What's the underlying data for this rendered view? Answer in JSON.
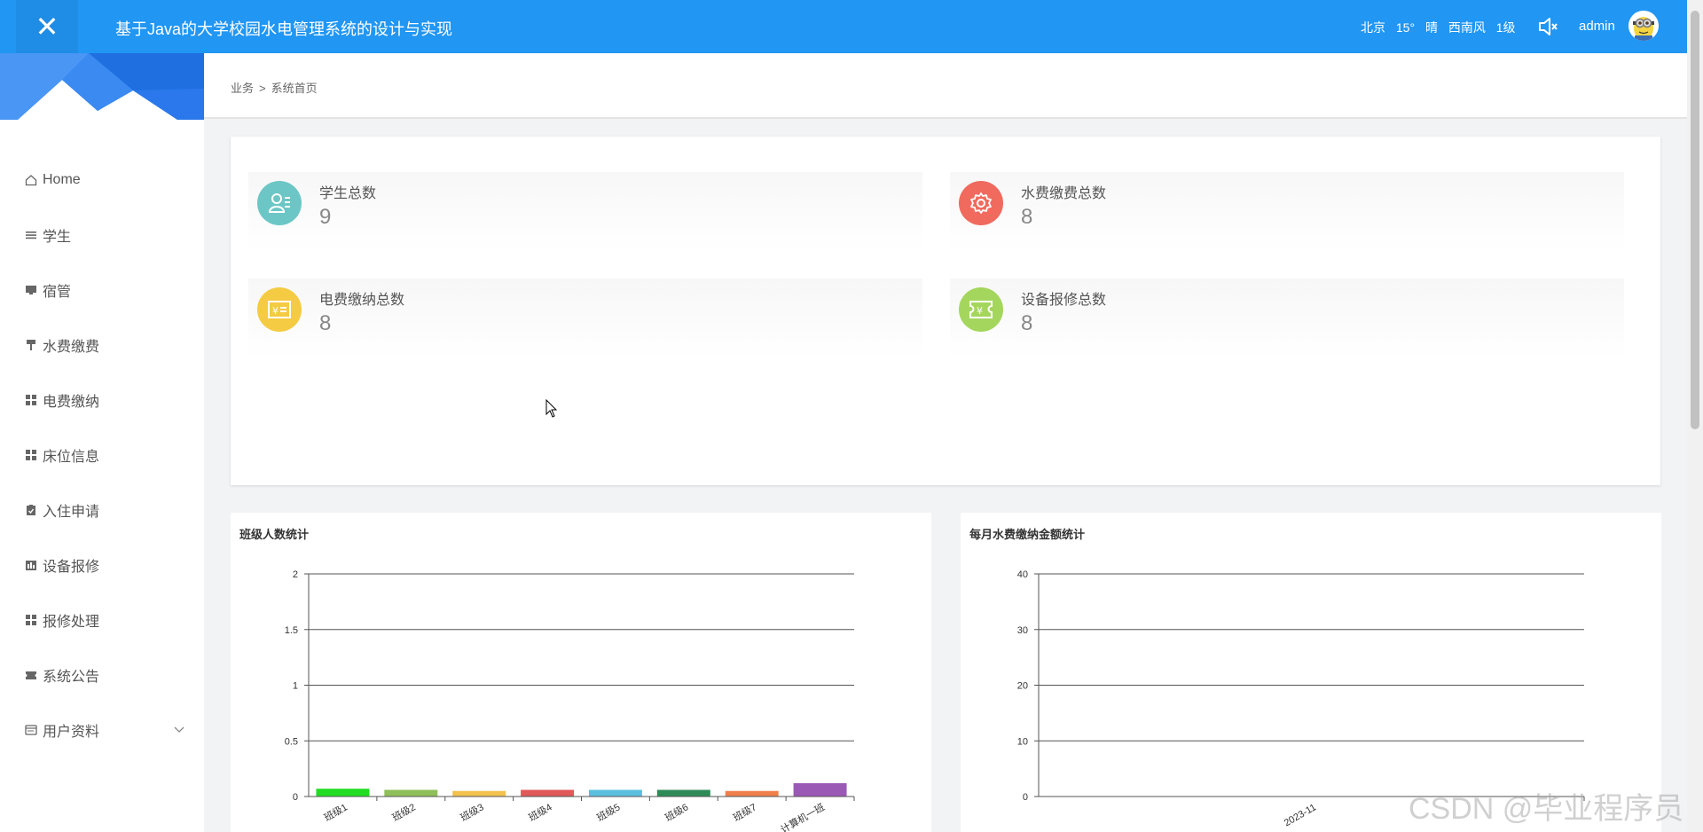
{
  "header": {
    "title": "基于Java的大学校园水电管理系统的设计与实现",
    "weather": {
      "city": "北京",
      "temperature": "15°",
      "condition": "晴",
      "wind": "西南风",
      "level": "1级"
    },
    "username": "admin"
  },
  "sidebar": {
    "items": [
      {
        "label": "Home",
        "icon": "home-icon"
      },
      {
        "label": "学生",
        "icon": "list-icon"
      },
      {
        "label": "宿管",
        "icon": "monitor-icon"
      },
      {
        "label": "水费缴费",
        "icon": "paint-roller-icon"
      },
      {
        "label": "电费缴纳",
        "icon": "grid-icon"
      },
      {
        "label": "床位信息",
        "icon": "grid-icon"
      },
      {
        "label": "入住申请",
        "icon": "clipboard-icon"
      },
      {
        "label": "设备报修",
        "icon": "chart-bar-icon"
      },
      {
        "label": "报修处理",
        "icon": "grid-icon"
      },
      {
        "label": "系统公告",
        "icon": "ticket-icon"
      },
      {
        "label": "用户资料",
        "icon": "id-card-icon"
      }
    ]
  },
  "breadcrumb": {
    "parent": "业务",
    "separator": ">",
    "current": "系统首页"
  },
  "stats": [
    {
      "label": "学生总数",
      "value": "9",
      "color": "#6cc6c6",
      "icon": "user-card-icon"
    },
    {
      "label": "水费缴费总数",
      "value": "8",
      "color": "#f06a5e",
      "icon": "gear-icon"
    },
    {
      "label": "电费缴纳总数",
      "value": "8",
      "color": "#f4cb42",
      "icon": "yen-card-icon"
    },
    {
      "label": "设备报修总数",
      "value": "8",
      "color": "#a4d65e",
      "icon": "yen-ticket-icon"
    }
  ],
  "charts": {
    "class_chart_title": "班级人数统计",
    "water_chart_title": "每月水费缴纳金额统计"
  },
  "chart_data": [
    {
      "type": "bar",
      "title": "班级人数统计",
      "categories": [
        "班级1",
        "班级2",
        "班级3",
        "班级4",
        "班级5",
        "班级6",
        "班级7",
        "计算机一班"
      ],
      "values": [
        0.07,
        0.06,
        0.05,
        0.06,
        0.06,
        0.06,
        0.05,
        0.12
      ],
      "colors": [
        "#22dd22",
        "#8fbf5a",
        "#f2c14e",
        "#e05a5a",
        "#5bc0de",
        "#2e8b57",
        "#f0804a",
        "#9b59b6"
      ],
      "yticks": [
        "0",
        "0.5",
        "1",
        "1.5",
        "2"
      ],
      "ylim": [
        0,
        2
      ],
      "grid": true
    },
    {
      "type": "bar",
      "title": "每月水费缴纳金额统计",
      "categories": [
        "2023-11"
      ],
      "values": [
        0
      ],
      "yticks": [
        "0",
        "10",
        "20",
        "30",
        "40"
      ],
      "ylim": [
        0,
        40
      ],
      "grid": true
    }
  ],
  "watermark": "CSDN @毕业程序员"
}
